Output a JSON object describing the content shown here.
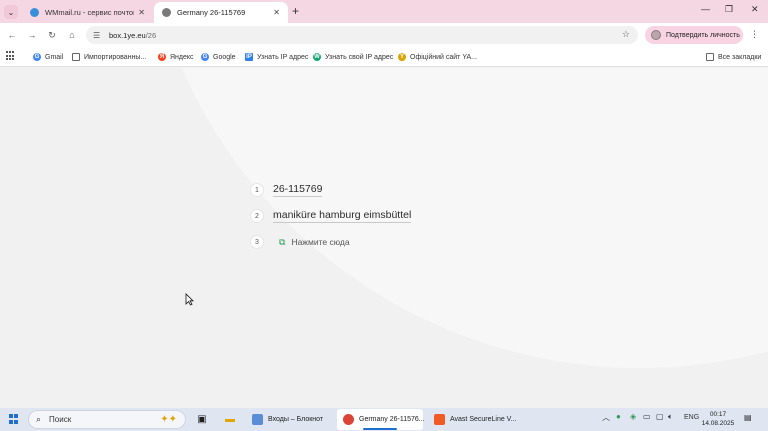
{
  "browser": {
    "tabs": [
      {
        "title": "WMmail.ru - сервис почтовых",
        "icon": "wmmail-icon",
        "active": false
      },
      {
        "title": "Germany 26-115769",
        "icon": "globe-icon",
        "active": true
      }
    ],
    "url_host": "box.1ye.eu",
    "url_path": "/26",
    "verify_label": "Подтвердить личность"
  },
  "bookmarks": [
    {
      "label": "Gmail",
      "icon": "google-icon",
      "color": "#4285f4"
    },
    {
      "label": "Импортированны...",
      "icon": "folder-icon",
      "color": "#666666"
    },
    {
      "label": "Яндекс",
      "icon": "yandex-icon",
      "color": "#fc3f1d"
    },
    {
      "label": "Google",
      "icon": "google-icon",
      "color": "#4285f4"
    },
    {
      "label": "Узнать IP адрес",
      "icon": "ip-icon",
      "color": "#2f80ed"
    },
    {
      "label": "Узнать свой IP адрес",
      "icon": "ip-icon",
      "color": "#17a673"
    },
    {
      "label": "Офіційний сайт YA...",
      "icon": "ya-icon",
      "color": "#d9a400"
    }
  ],
  "all_bookmarks": "Все закладки",
  "results": [
    {
      "num": "1",
      "text": "26-115769"
    },
    {
      "num": "2",
      "text": "maniküre hamburg eimsbüttel"
    },
    {
      "num": "3",
      "text": "Нажмите сюда"
    }
  ],
  "taskbar": {
    "search": "Поиск",
    "apps": [
      {
        "label": "Входы – Блокнот",
        "icon": "notepad-icon",
        "color": "#5b8dd6"
      },
      {
        "label": "Germany 26-11576...",
        "icon": "chrome-icon",
        "color": "#db4437"
      },
      {
        "label": "Avast SecureLine V...",
        "icon": "avast-icon",
        "color": "#f15a24"
      }
    ],
    "lang": "ENG",
    "time": "00:17",
    "date": "14.08.2025"
  }
}
